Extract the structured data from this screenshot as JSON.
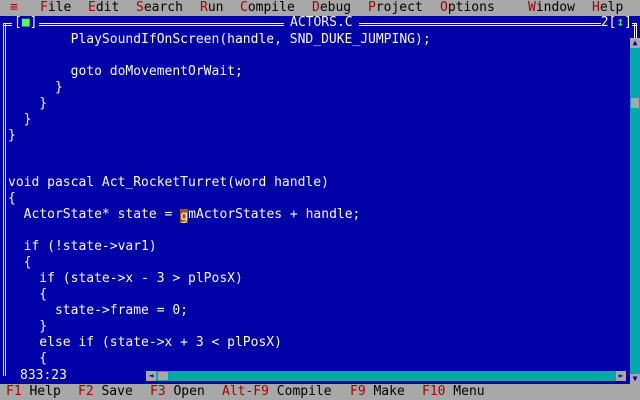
{
  "menu": {
    "system_glyph": "≡",
    "items": [
      {
        "hotkey": "F",
        "rest": "ile"
      },
      {
        "hotkey": "E",
        "rest": "dit"
      },
      {
        "hotkey": "S",
        "rest": "earch"
      },
      {
        "hotkey": "R",
        "rest": "un"
      },
      {
        "hotkey": "C",
        "rest": "ompile"
      },
      {
        "hotkey": "D",
        "rest": "ebug"
      },
      {
        "hotkey": "P",
        "rest": "roject"
      },
      {
        "hotkey": "O",
        "rest": "ptions"
      },
      {
        "hotkey": "W",
        "rest": "indow"
      },
      {
        "hotkey": "H",
        "rest": "elp"
      }
    ]
  },
  "window": {
    "title": "ACTORS.C",
    "close_left": "[",
    "close_glyph": "■",
    "close_right": "]",
    "number": "2",
    "zoom_left": "[",
    "zoom_glyph": "↕",
    "zoom_right": "]",
    "cursor_position": "833:23"
  },
  "code": {
    "lines": [
      "        PlaySoundIfOnScreen(handle, SND_DUKE_JUMPING);",
      "",
      "        goto doMovementOrWait;",
      "      }",
      "    }",
      "  }",
      "}",
      "",
      "",
      "void pascal Act_RocketTurret(word handle)",
      "{",
      "",
      "",
      "  if (!state->var1)",
      "  {",
      "    if (state->x - 3 > plPosX)",
      "    {",
      "      state->frame = 0;",
      "    }",
      "    else if (state->x + 3 < plPosX)",
      "    {"
    ],
    "cursor_line_before": "  ActorState* state = ",
    "cursor_char": "g",
    "cursor_line_after": "mActorStates + handle;"
  },
  "scroll": {
    "up_glyph": "▲",
    "down_glyph": "▼",
    "left_glyph": "◄",
    "right_glyph": "►"
  },
  "function_keys": [
    {
      "key": "F1",
      "label": " Help"
    },
    {
      "key": "F2",
      "label": " Save"
    },
    {
      "key": "F3",
      "label": " Open"
    },
    {
      "key": "Alt-F9",
      "label": " Compile"
    },
    {
      "key": "F9",
      "label": " Make"
    },
    {
      "key": "F10",
      "label": " Menu"
    }
  ],
  "colors": {
    "desktop_blue": "#0000a8",
    "menu_gray": "#a8a8a8",
    "hotkey_red": "#a80000",
    "scrollbar_cyan": "#00a8a8",
    "cursor_orange": "#a85400",
    "indicator_green": "#54fc54"
  }
}
